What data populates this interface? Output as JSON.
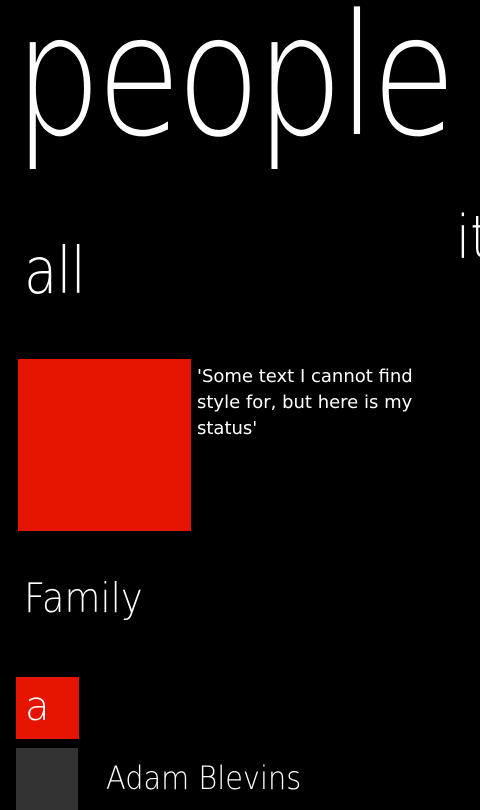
{
  "header": {
    "title": "people"
  },
  "pivot": {
    "current": "all",
    "next_peek": "it"
  },
  "profile": {
    "status": "'Some text I cannot find style for, but here is my status'"
  },
  "groups": [
    {
      "name": "Family",
      "jump_letter": "a",
      "contacts": [
        {
          "name": "Adam Blevins"
        }
      ]
    }
  ],
  "colors": {
    "background": "#000000",
    "accent": "#e51400",
    "avatar_placeholder": "#333333",
    "text": "#ffffff"
  }
}
